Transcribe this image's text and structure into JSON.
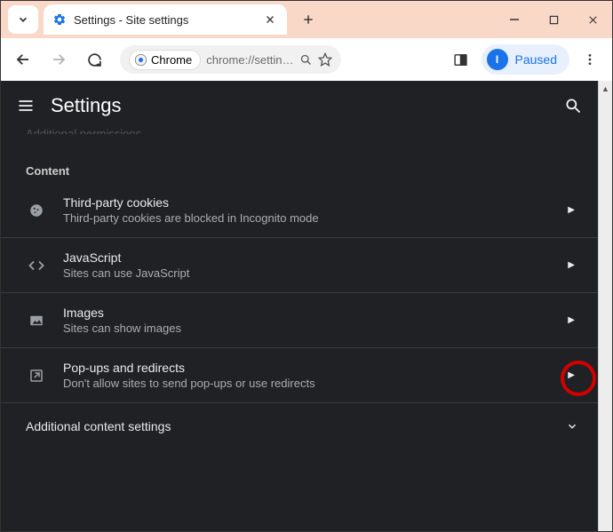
{
  "titlebar": {
    "tab_title": "Settings - Site settings"
  },
  "toolbar": {
    "chrome_label": "Chrome",
    "url_display": "chrome://settin…",
    "paused_label": "Paused",
    "avatar_initial": "I"
  },
  "page": {
    "header_title": "Settings",
    "cutoff_text": "Additional permissions",
    "section_label": "Content",
    "rows": [
      {
        "title": "Third-party cookies",
        "desc": "Third-party cookies are blocked in Incognito mode"
      },
      {
        "title": "JavaScript",
        "desc": "Sites can use JavaScript"
      },
      {
        "title": "Images",
        "desc": "Sites can show images"
      },
      {
        "title": "Pop-ups and redirects",
        "desc": "Don't allow sites to send pop-ups or use redirects"
      }
    ],
    "additional_label": "Additional content settings"
  }
}
